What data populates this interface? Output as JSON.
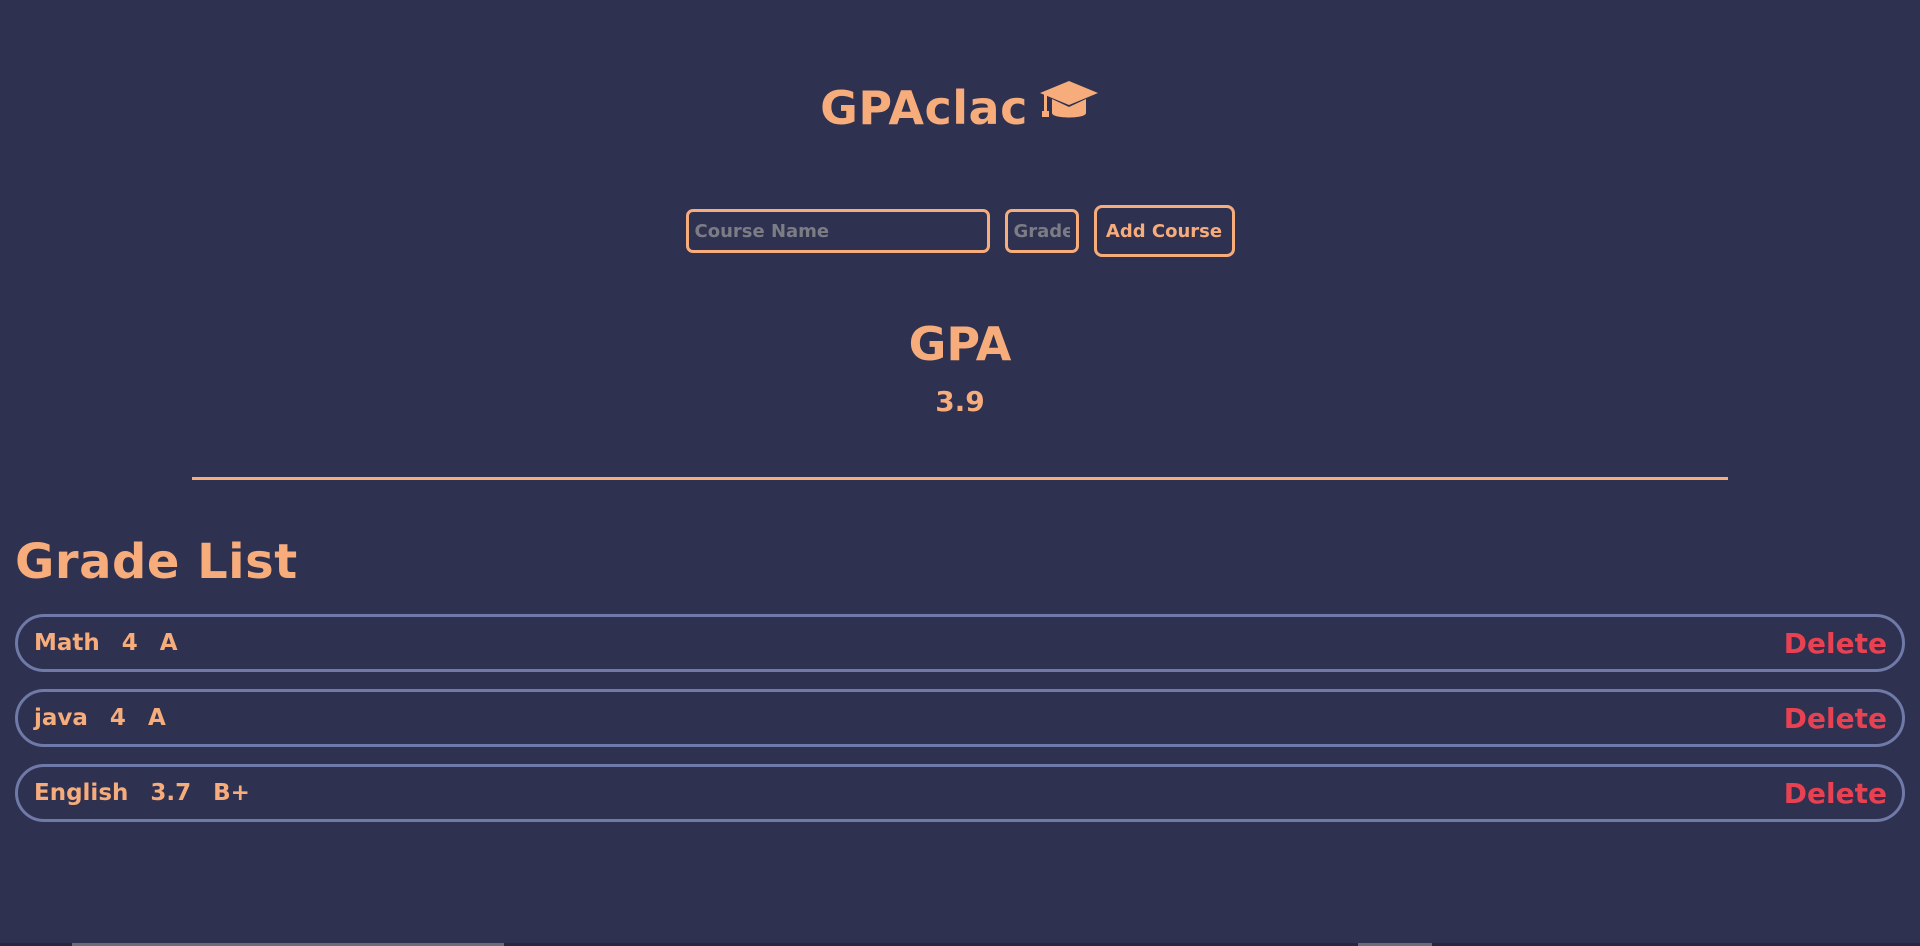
{
  "header": {
    "title": "GPAclac",
    "icon": "graduation-cap-icon"
  },
  "form": {
    "course_placeholder": "Course Name",
    "grade_placeholder": "Grade",
    "course_value": "",
    "grade_value": "",
    "add_label": "Add Course"
  },
  "gpa": {
    "heading": "GPA",
    "value": "3.9"
  },
  "grade_list": {
    "heading": "Grade List",
    "delete_label": "Delete",
    "items": [
      {
        "course": "Math",
        "points": "4",
        "letter": "A"
      },
      {
        "course": "java",
        "points": "4",
        "letter": "A"
      },
      {
        "course": "English",
        "points": "3.7",
        "letter": "B+"
      }
    ]
  },
  "colors": {
    "background": "#2e3150",
    "accent": "#f7ac7c",
    "row_border": "#6f7aa8",
    "delete": "#e84152"
  }
}
